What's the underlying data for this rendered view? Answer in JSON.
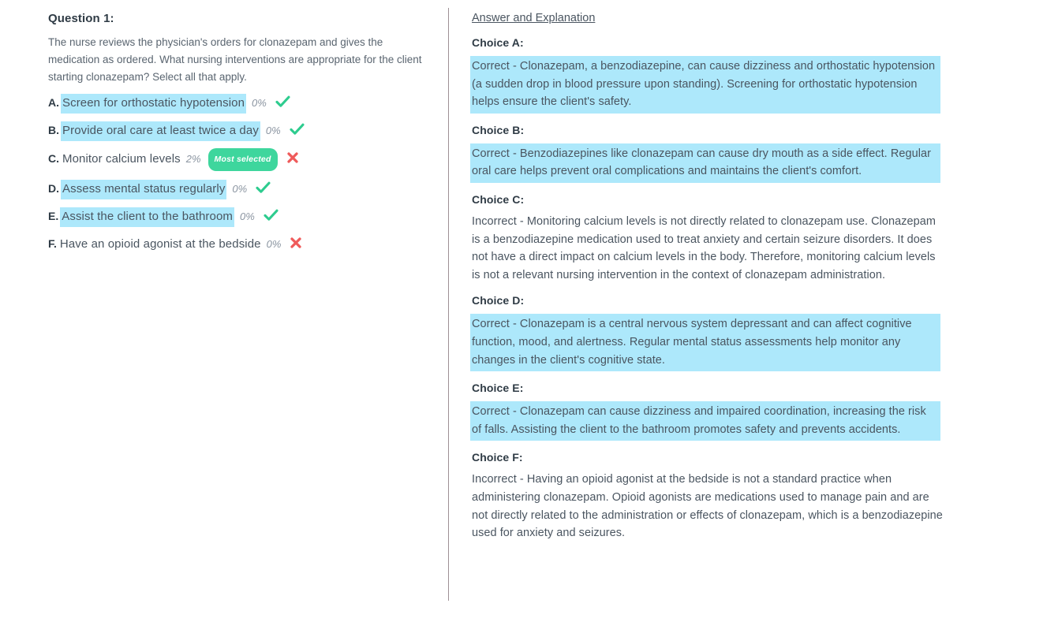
{
  "question": {
    "title": "Question 1:",
    "stem": "The nurse reviews the physician's orders for clonazepam and gives the medication as ordered. What nursing interventions are appropriate for the client starting clonazepam? Select all that apply.",
    "choices": [
      {
        "letter": "A.",
        "text": "Screen for orthostatic hypotension",
        "percent": "0%",
        "highlighted": true,
        "mark": "check-icon",
        "badge": null
      },
      {
        "letter": "B.",
        "text": "Provide oral care at least twice a day",
        "percent": "0%",
        "highlighted": true,
        "mark": "check-icon",
        "badge": null
      },
      {
        "letter": "C.",
        "text": "Monitor calcium levels",
        "percent": "2%",
        "highlighted": false,
        "mark": "cross-icon",
        "badge": "Most selected"
      },
      {
        "letter": "D.",
        "text": "Assess mental status regularly",
        "percent": "0%",
        "highlighted": true,
        "mark": "check-icon",
        "badge": null
      },
      {
        "letter": "E.",
        "text": "Assist the client to the bathroom",
        "percent": "0%",
        "highlighted": true,
        "mark": "check-icon",
        "badge": null
      },
      {
        "letter": "F.",
        "text": "Have an opioid agonist at the bedside",
        "percent": "0%",
        "highlighted": false,
        "mark": "cross-icon",
        "badge": null
      }
    ]
  },
  "explanation": {
    "heading": "Answer and Explanation",
    "items": [
      {
        "label": "Choice A:",
        "body": "Correct - Clonazepam, a benzodiazepine, can cause dizziness and orthostatic hypotension (a sudden drop in blood pressure upon standing). Screening for orthostatic hypotension helps ensure the client's safety.",
        "highlighted": true
      },
      {
        "label": "Choice B:",
        "body": "Correct - Benzodiazepines like clonazepam can cause dry mouth as a side effect. Regular oral care helps prevent oral complications and maintains the client's comfort.",
        "highlighted": true
      },
      {
        "label": "Choice C:",
        "body": "Incorrect - Monitoring calcium levels is not directly related to clonazepam use. Clonazepam is a benzodiazepine medication used to treat anxiety and certain seizure disorders. It does not have a direct impact on calcium levels in the body. Therefore, monitoring calcium levels is not a relevant nursing intervention in the context of clonazepam administration.",
        "highlighted": false
      },
      {
        "label": "Choice D:",
        "body": "Correct - Clonazepam is a central nervous system depressant and can affect cognitive function, mood, and alertness. Regular mental status assessments help monitor any changes in the client's cognitive state.",
        "highlighted": true
      },
      {
        "label": "Choice E:",
        "body": "Correct - Clonazepam can cause dizziness and impaired coordination, increasing the risk of falls. Assisting the client to the bathroom promotes safety and prevents accidents.",
        "highlighted": true
      },
      {
        "label": "Choice F:",
        "body": "Incorrect - Having an opioid agonist at the bedside is not a standard practice when administering clonazepam. Opioid agonists are medications used to manage pain and are not directly related to the administration or effects of clonazepam, which is a benzodiazepine used for anxiety and seizures.",
        "highlighted": false
      }
    ]
  },
  "colors": {
    "highlight": "#ade8fb",
    "badge_green": "#3ed69d",
    "check_green": "#2ecc8f",
    "cross_red": "#ef5a5a",
    "text": "#4a5560",
    "divider": "#7d6b72"
  }
}
